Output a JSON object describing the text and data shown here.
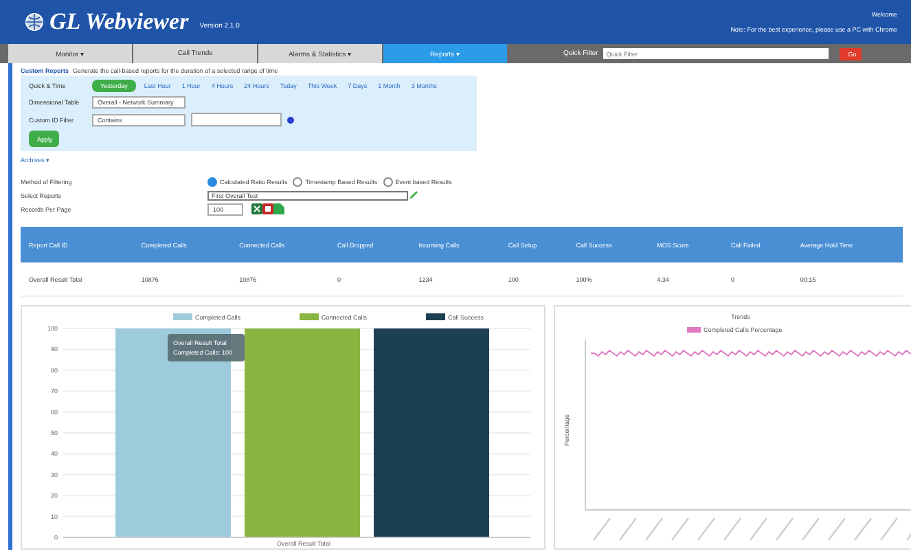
{
  "header": {
    "title": "GL Webviewer",
    "version": "Version 2.1.0",
    "user": "Welcome",
    "note": "Note: For the best experience, please use a PC with Chrome"
  },
  "nav": {
    "tabs": [
      {
        "label": "Monitor ▾",
        "selected": false
      },
      {
        "label": "Call Trends",
        "selected": false
      },
      {
        "label": "Alarms & Statistics ▾",
        "selected": false
      },
      {
        "label": "Reports ▾",
        "selected": true
      }
    ],
    "quick_filter": {
      "label": "Quick Filter",
      "placeholder": "Quick Filter",
      "button": "Go"
    }
  },
  "breadcrumb": {
    "title": "Custom Reports",
    "text": "Generate the call-based reports for the duration of a selected range of time"
  },
  "filters": {
    "time_label": "Quick & Time",
    "time_options": [
      {
        "label": "Yesterday",
        "selected": true
      },
      {
        "label": "Last Hour",
        "selected": false
      },
      {
        "label": "1 Hour",
        "selected": false
      },
      {
        "label": "4 Hours",
        "selected": false
      },
      {
        "label": "24 Hours",
        "selected": false
      },
      {
        "label": "Today",
        "selected": false
      },
      {
        "label": "This Week",
        "selected": false
      },
      {
        "label": "7 Days",
        "selected": false
      },
      {
        "label": "1 Month",
        "selected": false
      },
      {
        "label": "3 Months",
        "selected": false
      }
    ],
    "table_label": "Dimensional Table",
    "table_value": "Overall - Network Summary",
    "id_label": "Custom ID Filter",
    "id_operator": "Contains",
    "apply": "Apply"
  },
  "archives": "Archives ▾",
  "options": {
    "method_label": "Method of Filtering",
    "methods": [
      {
        "label": "Calculated Ratio Results",
        "selected": true
      },
      {
        "label": "Timestamp Based Results",
        "selected": false
      },
      {
        "label": "Event based Results",
        "selected": false
      }
    ],
    "reports_label": "Select Reports",
    "report": "First Overall Test",
    "records_label": "Records Per Page",
    "records": "100"
  },
  "table": {
    "columns": [
      "Report Call ID",
      "Completed Calls",
      "Connected Calls",
      "Call Dropped",
      "Incoming Calls",
      "Call Setup",
      "Call Success",
      "MOS Score",
      "Call Failed",
      "Average Hold Time"
    ],
    "rows": [
      [
        "Overall Result Total",
        "10876",
        "10876",
        "0",
        "1234",
        "100",
        "100%",
        "4.34",
        "0",
        "00:15"
      ]
    ]
  },
  "bar_chart": {
    "tooltip": [
      "Overall Result Total",
      "Completed Calls: 100"
    ],
    "chart_data": {
      "type": "bar",
      "grid": true,
      "legend": true,
      "categories": [
        "Overall Result Total"
      ],
      "ylim": [
        0,
        100
      ],
      "yticks": [
        0,
        10,
        20,
        30,
        40,
        50,
        60,
        70,
        80,
        90,
        100
      ],
      "series": [
        {
          "name": "Completed Calls",
          "color": "#9ecbdc",
          "values": [
            100
          ]
        },
        {
          "name": "Connected Calls",
          "color": "#8ab540",
          "values": [
            100
          ]
        },
        {
          "name": "Call Success",
          "color": "#1d3f52",
          "values": [
            100
          ]
        }
      ]
    }
  },
  "line_chart": {
    "title": "Trends",
    "legend": "Completed Calls Percentage",
    "ylabel": "Percentage"
  }
}
